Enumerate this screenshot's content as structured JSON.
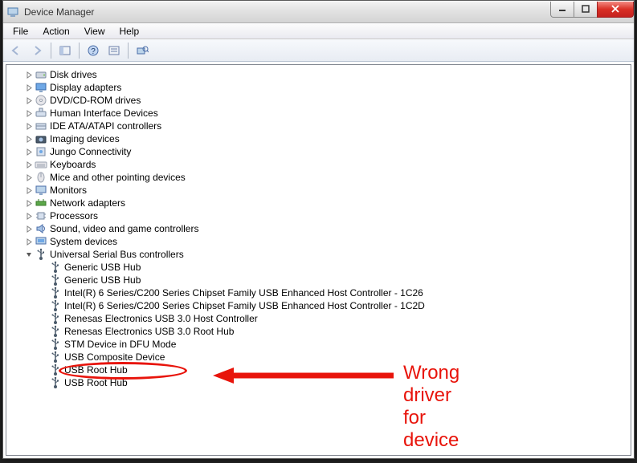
{
  "window": {
    "title": "Device Manager"
  },
  "menu": {
    "items": [
      "File",
      "Action",
      "View",
      "Help"
    ]
  },
  "tree": {
    "nodes": [
      {
        "depth": 1,
        "expander": "closed",
        "icon": "disk",
        "label": "Disk drives"
      },
      {
        "depth": 1,
        "expander": "closed",
        "icon": "display",
        "label": "Display adapters"
      },
      {
        "depth": 1,
        "expander": "closed",
        "icon": "dvd",
        "label": "DVD/CD-ROM drives"
      },
      {
        "depth": 1,
        "expander": "closed",
        "icon": "hid",
        "label": "Human Interface Devices"
      },
      {
        "depth": 1,
        "expander": "closed",
        "icon": "ide",
        "label": "IDE ATA/ATAPI controllers"
      },
      {
        "depth": 1,
        "expander": "closed",
        "icon": "imaging",
        "label": "Imaging devices"
      },
      {
        "depth": 1,
        "expander": "closed",
        "icon": "jungo",
        "label": "Jungo Connectivity"
      },
      {
        "depth": 1,
        "expander": "closed",
        "icon": "keyboard",
        "label": "Keyboards"
      },
      {
        "depth": 1,
        "expander": "closed",
        "icon": "mouse",
        "label": "Mice and other pointing devices"
      },
      {
        "depth": 1,
        "expander": "closed",
        "icon": "monitor",
        "label": "Monitors"
      },
      {
        "depth": 1,
        "expander": "closed",
        "icon": "network",
        "label": "Network adapters"
      },
      {
        "depth": 1,
        "expander": "closed",
        "icon": "cpu",
        "label": "Processors"
      },
      {
        "depth": 1,
        "expander": "closed",
        "icon": "sound",
        "label": "Sound, video and game controllers"
      },
      {
        "depth": 1,
        "expander": "closed",
        "icon": "system",
        "label": "System devices"
      },
      {
        "depth": 1,
        "expander": "open",
        "icon": "usb",
        "label": "Universal Serial Bus controllers"
      },
      {
        "depth": 2,
        "expander": "none",
        "icon": "usb",
        "label": "Generic USB Hub"
      },
      {
        "depth": 2,
        "expander": "none",
        "icon": "usb",
        "label": "Generic USB Hub"
      },
      {
        "depth": 2,
        "expander": "none",
        "icon": "usb",
        "label": "Intel(R) 6 Series/C200 Series Chipset Family USB Enhanced Host Controller - 1C26"
      },
      {
        "depth": 2,
        "expander": "none",
        "icon": "usb",
        "label": "Intel(R) 6 Series/C200 Series Chipset Family USB Enhanced Host Controller - 1C2D"
      },
      {
        "depth": 2,
        "expander": "none",
        "icon": "usb",
        "label": "Renesas Electronics USB 3.0 Host Controller"
      },
      {
        "depth": 2,
        "expander": "none",
        "icon": "usb",
        "label": "Renesas Electronics USB 3.0 Root Hub"
      },
      {
        "depth": 2,
        "expander": "none",
        "icon": "usb",
        "label": "STM Device in DFU Mode"
      },
      {
        "depth": 2,
        "expander": "none",
        "icon": "usb",
        "label": "USB Composite Device"
      },
      {
        "depth": 2,
        "expander": "none",
        "icon": "usb",
        "label": "USB Root Hub"
      },
      {
        "depth": 2,
        "expander": "none",
        "icon": "usb",
        "label": "USB Root Hub"
      }
    ]
  },
  "annotation": {
    "text": "Wrong driver for device"
  }
}
